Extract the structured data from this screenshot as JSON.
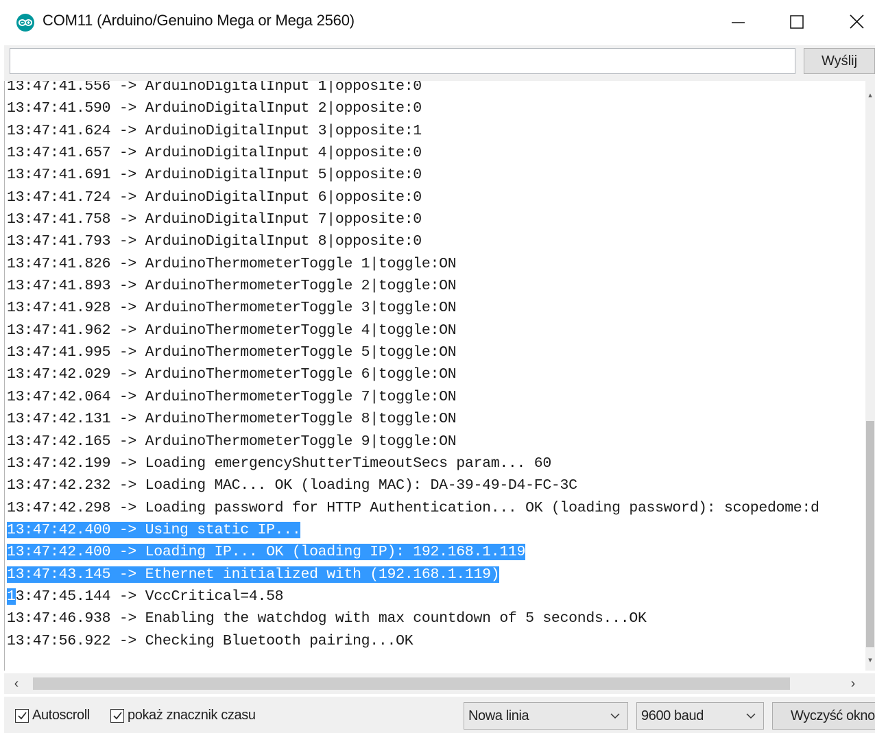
{
  "window": {
    "title": "COM11 (Arduino/Genuino Mega or Mega 2560)",
    "icon": "arduino-logo-icon",
    "controls": [
      "minimize-icon",
      "maximize-icon",
      "close-icon"
    ]
  },
  "send_bar": {
    "input_value": "",
    "send_label": "Wyślij"
  },
  "serial_output": {
    "lines": [
      {
        "plain": "13:47:41.556 -> ArduinoDigitalInput 1|opposite:0",
        "sel": "",
        "rest": ""
      },
      {
        "plain": "13:47:41.590 -> ArduinoDigitalInput 2|opposite:0",
        "sel": "",
        "rest": ""
      },
      {
        "plain": "13:47:41.624 -> ArduinoDigitalInput 3|opposite:1",
        "sel": "",
        "rest": ""
      },
      {
        "plain": "13:47:41.657 -> ArduinoDigitalInput 4|opposite:0",
        "sel": "",
        "rest": ""
      },
      {
        "plain": "13:47:41.691 -> ArduinoDigitalInput 5|opposite:0",
        "sel": "",
        "rest": ""
      },
      {
        "plain": "13:47:41.724 -> ArduinoDigitalInput 6|opposite:0",
        "sel": "",
        "rest": ""
      },
      {
        "plain": "13:47:41.758 -> ArduinoDigitalInput 7|opposite:0",
        "sel": "",
        "rest": ""
      },
      {
        "plain": "13:47:41.793 -> ArduinoDigitalInput 8|opposite:0",
        "sel": "",
        "rest": ""
      },
      {
        "plain": "13:47:41.826 -> ArduinoThermometerToggle 1|toggle:ON",
        "sel": "",
        "rest": ""
      },
      {
        "plain": "13:47:41.893 -> ArduinoThermometerToggle 2|toggle:ON",
        "sel": "",
        "rest": ""
      },
      {
        "plain": "13:47:41.928 -> ArduinoThermometerToggle 3|toggle:ON",
        "sel": "",
        "rest": ""
      },
      {
        "plain": "13:47:41.962 -> ArduinoThermometerToggle 4|toggle:ON",
        "sel": "",
        "rest": ""
      },
      {
        "plain": "13:47:41.995 -> ArduinoThermometerToggle 5|toggle:ON",
        "sel": "",
        "rest": ""
      },
      {
        "plain": "13:47:42.029 -> ArduinoThermometerToggle 6|toggle:ON",
        "sel": "",
        "rest": ""
      },
      {
        "plain": "13:47:42.064 -> ArduinoThermometerToggle 7|toggle:ON",
        "sel": "",
        "rest": ""
      },
      {
        "plain": "13:47:42.131 -> ArduinoThermometerToggle 8|toggle:ON",
        "sel": "",
        "rest": ""
      },
      {
        "plain": "13:47:42.165 -> ArduinoThermometerToggle 9|toggle:ON",
        "sel": "",
        "rest": ""
      },
      {
        "plain": "13:47:42.199 -> Loading emergencyShutterTimeoutSecs param... 60",
        "sel": "",
        "rest": ""
      },
      {
        "plain": "13:47:42.232 -> Loading MAC... OK (loading MAC): DA-39-49-D4-FC-3C",
        "sel": "",
        "rest": ""
      },
      {
        "plain": "13:47:42.298 -> Loading password for HTTP Authentication... OK (loading password): scopedome:d",
        "sel": "",
        "rest": ""
      },
      {
        "plain": "",
        "sel": "13:47:42.400 -> Using static IP...",
        "rest": ""
      },
      {
        "plain": "",
        "sel": "13:47:42.400 -> Loading IP... OK (loading IP): 192.168.1.119",
        "rest": ""
      },
      {
        "plain": "",
        "sel": "13:47:43.145 -> Ethernet initialized with (192.168.1.119)",
        "rest": ""
      },
      {
        "plain": "",
        "sel": "1",
        "rest": "3:47:45.144 -> VccCritical=4.58"
      },
      {
        "plain": "13:47:46.938 -> Enabling the watchdog with max countdown of 5 seconds...OK",
        "sel": "",
        "rest": ""
      },
      {
        "plain": "13:47:56.922 -> Checking Bluetooth pairing...OK",
        "sel": "",
        "rest": ""
      }
    ],
    "selection_color": "#3399ff"
  },
  "bottom_bar": {
    "autoscroll_label": "Autoscroll",
    "autoscroll_checked": true,
    "timestamp_label": "pokaż znacznik czasu",
    "timestamp_checked": true,
    "line_ending_value": "Nowa linia",
    "baud_value": "9600 baud",
    "clear_label": "Wyczyść okno"
  }
}
